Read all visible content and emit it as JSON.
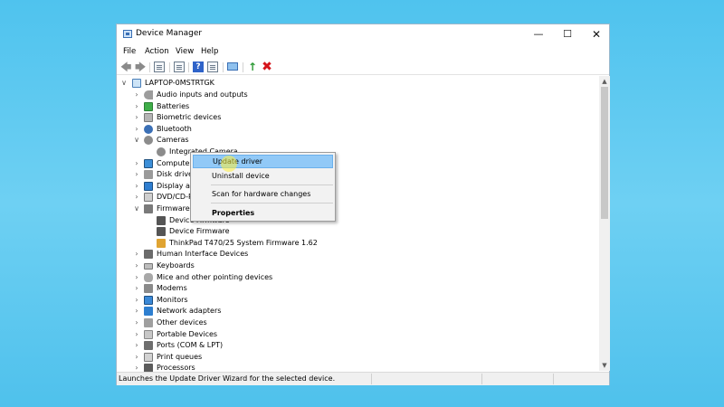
{
  "window": {
    "title": "Device Manager"
  },
  "menubar": [
    "File",
    "Action",
    "View",
    "Help"
  ],
  "tree": {
    "root": "LAPTOP-0MSTRTGK",
    "rows": [
      {
        "label": "Audio inputs and outputs",
        "icon": "speaker-icon"
      },
      {
        "label": "Batteries",
        "icon": "battery-icon"
      },
      {
        "label": "Biometric devices",
        "icon": "biometric-icon"
      },
      {
        "label": "Bluetooth",
        "icon": "bluetooth-icon"
      },
      {
        "label": "Cameras",
        "icon": "camera-icon"
      },
      {
        "label": "Integrated Camera",
        "icon": "camera-icon"
      },
      {
        "label": "Computer",
        "icon": "computer-icon"
      },
      {
        "label": "Disk drives",
        "icon": "disk-drive-icon"
      },
      {
        "label": "Display ad",
        "icon": "display-adapter-icon"
      },
      {
        "label": "DVD/CD-R",
        "icon": "dvd-drive-icon"
      },
      {
        "label": "Firmware",
        "icon": "firmware-icon"
      },
      {
        "label": "Device Firmware",
        "icon": "chip-icon"
      },
      {
        "label": "Device Firmware",
        "icon": "chip-icon"
      },
      {
        "label": "ThinkPad T470/25 System Firmware 1.62",
        "icon": "chip-icon"
      },
      {
        "label": "Human Interface Devices",
        "icon": "hid-icon"
      },
      {
        "label": "Keyboards",
        "icon": "keyboard-icon"
      },
      {
        "label": "Mice and other pointing devices",
        "icon": "mouse-icon"
      },
      {
        "label": "Modems",
        "icon": "modem-icon"
      },
      {
        "label": "Monitors",
        "icon": "monitor-icon"
      },
      {
        "label": "Network adapters",
        "icon": "network-icon"
      },
      {
        "label": "Other devices",
        "icon": "other-devices-icon"
      },
      {
        "label": "Portable Devices",
        "icon": "portable-device-icon"
      },
      {
        "label": "Ports (COM & LPT)",
        "icon": "port-icon"
      },
      {
        "label": "Print queues",
        "icon": "printer-icon"
      },
      {
        "label": "Processors",
        "icon": "processor-icon"
      }
    ]
  },
  "context_menu": {
    "items": [
      "Update driver",
      "Uninstall device",
      "Scan for hardware changes",
      "Properties"
    ],
    "highlighted": "Update driver"
  },
  "status": {
    "text": "Launches the Update Driver Wizard for the selected device."
  }
}
